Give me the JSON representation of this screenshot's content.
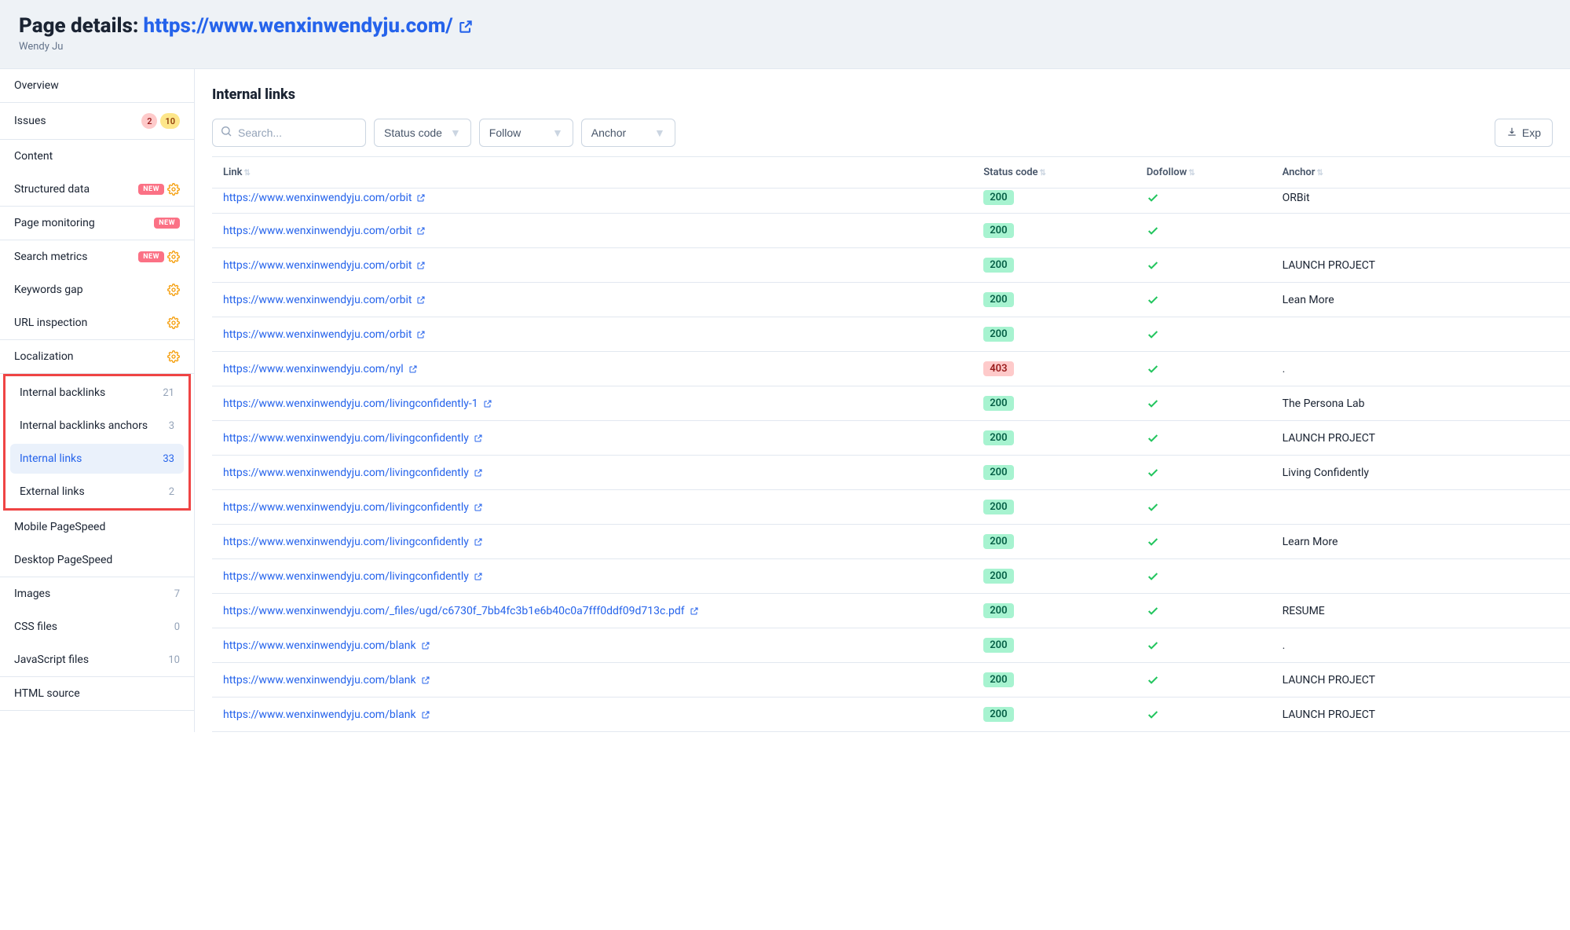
{
  "header": {
    "label": "Page details:",
    "url": "https://www.wenxinwendyju.com/",
    "subtitle": "Wendy Ju"
  },
  "sidebar": {
    "sections": [
      {
        "type": "simple",
        "items": [
          {
            "label": "Overview"
          }
        ]
      },
      {
        "type": "simple",
        "items": [
          {
            "label": "Issues",
            "badges": [
              {
                "text": "2",
                "style": "red"
              },
              {
                "text": "10",
                "style": "amber"
              }
            ]
          }
        ]
      },
      {
        "type": "simple",
        "items": [
          {
            "label": "Content"
          },
          {
            "label": "Structured data",
            "new": true,
            "gear": true
          }
        ]
      },
      {
        "type": "simple",
        "items": [
          {
            "label": "Page monitoring",
            "new": true
          }
        ]
      },
      {
        "type": "simple",
        "items": [
          {
            "label": "Search metrics",
            "new": true,
            "gear": true
          },
          {
            "label": "Keywords gap",
            "gear": true
          },
          {
            "label": "URL inspection",
            "gear": true
          }
        ]
      },
      {
        "type": "simple",
        "items": [
          {
            "label": "Localization",
            "gear": true
          }
        ]
      },
      {
        "type": "highlight",
        "items": [
          {
            "label": "Internal backlinks",
            "count": "21"
          },
          {
            "label": "Internal backlinks anchors",
            "count": "3"
          },
          {
            "label": "Internal links",
            "count": "33",
            "active": true
          },
          {
            "label": "External links",
            "count": "2"
          }
        ]
      },
      {
        "type": "simple",
        "items": [
          {
            "label": "Mobile PageSpeed"
          },
          {
            "label": "Desktop PageSpeed"
          }
        ]
      },
      {
        "type": "simple",
        "items": [
          {
            "label": "Images",
            "count": "7"
          },
          {
            "label": "CSS files",
            "count": "0"
          },
          {
            "label": "JavaScript files",
            "count": "10"
          }
        ]
      },
      {
        "type": "simple",
        "items": [
          {
            "label": "HTML source"
          }
        ]
      }
    ]
  },
  "main": {
    "title": "Internal links",
    "search_placeholder": "Search...",
    "filters": {
      "status": "Status code",
      "follow": "Follow",
      "anchor": "Anchor"
    },
    "export": "Exp",
    "columns": {
      "link": "Link",
      "status": "Status code",
      "dofollow": "Dofollow",
      "anchor": "Anchor"
    },
    "rows": [
      {
        "url": "https://www.wenxinwendyju.com/orbit",
        "status": 200,
        "dofollow": true,
        "anchor": "ORBit",
        "partial": true
      },
      {
        "url": "https://www.wenxinwendyju.com/orbit",
        "status": 200,
        "dofollow": true,
        "anchor": ""
      },
      {
        "url": "https://www.wenxinwendyju.com/orbit",
        "status": 200,
        "dofollow": true,
        "anchor": "LAUNCH PROJECT"
      },
      {
        "url": "https://www.wenxinwendyju.com/orbit",
        "status": 200,
        "dofollow": true,
        "anchor": "Lean More"
      },
      {
        "url": "https://www.wenxinwendyju.com/orbit",
        "status": 200,
        "dofollow": true,
        "anchor": ""
      },
      {
        "url": "https://www.wenxinwendyju.com/nyl",
        "status": 403,
        "dofollow": true,
        "anchor": "."
      },
      {
        "url": "https://www.wenxinwendyju.com/livingconfidently-1",
        "status": 200,
        "dofollow": true,
        "anchor": "The Persona Lab"
      },
      {
        "url": "https://www.wenxinwendyju.com/livingconfidently",
        "status": 200,
        "dofollow": true,
        "anchor": "LAUNCH PROJECT"
      },
      {
        "url": "https://www.wenxinwendyju.com/livingconfidently",
        "status": 200,
        "dofollow": true,
        "anchor": "Living Confidently"
      },
      {
        "url": "https://www.wenxinwendyju.com/livingconfidently",
        "status": 200,
        "dofollow": true,
        "anchor": ""
      },
      {
        "url": "https://www.wenxinwendyju.com/livingconfidently",
        "status": 200,
        "dofollow": true,
        "anchor": "Learn More"
      },
      {
        "url": "https://www.wenxinwendyju.com/livingconfidently",
        "status": 200,
        "dofollow": true,
        "anchor": ""
      },
      {
        "url": "https://www.wenxinwendyju.com/_files/ugd/c6730f_7bb4fc3b1e6b40c0a7fff0ddf09d713c.pdf",
        "status": 200,
        "dofollow": true,
        "anchor": "RESUME"
      },
      {
        "url": "https://www.wenxinwendyju.com/blank",
        "status": 200,
        "dofollow": true,
        "anchor": "."
      },
      {
        "url": "https://www.wenxinwendyju.com/blank",
        "status": 200,
        "dofollow": true,
        "anchor": "LAUNCH PROJECT"
      },
      {
        "url": "https://www.wenxinwendyju.com/blank",
        "status": 200,
        "dofollow": true,
        "anchor": "LAUNCH PROJECT"
      }
    ]
  }
}
